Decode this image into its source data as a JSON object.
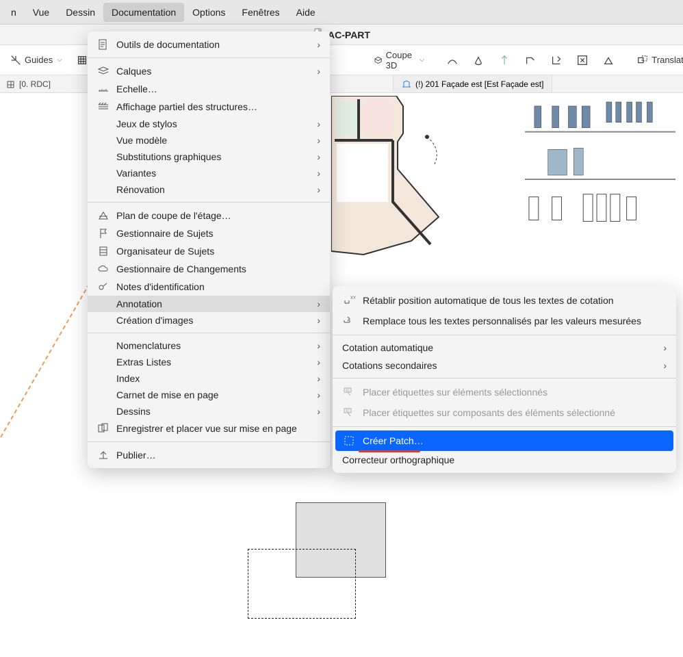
{
  "menubar": {
    "items": [
      "n",
      "Vue",
      "Dessin",
      "Documentation",
      "Options",
      "Fenêtres",
      "Aide"
    ],
    "active_index": 3
  },
  "window_title": "AC-PART",
  "toolbar": {
    "guides": "Guides",
    "coupe3d": "Coupe 3D",
    "translation": "Translation"
  },
  "tabs": {
    "left": "[0. RDC]",
    "right": "(!) 201 Façade est [Est Façade est]"
  },
  "dropdown": {
    "items": [
      {
        "label": "Outils de documentation",
        "arrow": true,
        "icon": "doc-tools"
      },
      {
        "sep": true
      },
      {
        "label": "Calques",
        "arrow": true,
        "icon": "layers"
      },
      {
        "label": "Echelle…",
        "icon": "scale"
      },
      {
        "label": "Affichage partiel des structures…",
        "icon": "partial"
      },
      {
        "label": "Jeux de stylos",
        "arrow": true,
        "noic": true
      },
      {
        "label": "Vue modèle",
        "arrow": true,
        "noic": true
      },
      {
        "label": "Substitutions graphiques",
        "arrow": true,
        "noic": true
      },
      {
        "label": "Variantes",
        "arrow": true,
        "noic": true
      },
      {
        "label": "Rénovation",
        "arrow": true,
        "noic": true
      },
      {
        "sep": true
      },
      {
        "label": "Plan de coupe de l'étage…",
        "icon": "cutplane"
      },
      {
        "label": "Gestionnaire de Sujets",
        "icon": "flag"
      },
      {
        "label": "Organisateur de Sujets",
        "icon": "org"
      },
      {
        "label": "Gestionnaire de Changements",
        "icon": "cloud"
      },
      {
        "label": "Notes d'identification",
        "icon": "note"
      },
      {
        "label": "Annotation",
        "arrow": true,
        "noic": true,
        "hovered": true
      },
      {
        "label": "Création d'images",
        "arrow": true,
        "noic": true
      },
      {
        "sep": true
      },
      {
        "label": "Nomenclatures",
        "arrow": true,
        "noic": true
      },
      {
        "label": "Extras Listes",
        "arrow": true,
        "noic": true
      },
      {
        "label": "Index",
        "arrow": true,
        "noic": true
      },
      {
        "label": "Carnet de mise en page",
        "arrow": true,
        "noic": true
      },
      {
        "label": "Dessins",
        "arrow": true,
        "noic": true
      },
      {
        "label": "Enregistrer et placer vue sur mise en page",
        "icon": "save"
      },
      {
        "sep": true
      },
      {
        "label": "Publier…",
        "icon": "publish"
      }
    ]
  },
  "submenu": {
    "items": [
      {
        "label": "Rétablir position automatique de tous les textes de cotation",
        "icon": "restore"
      },
      {
        "label": "Remplace tous les textes personnalisés par les valeurs mesurées",
        "icon": "replace"
      },
      {
        "sep": true
      },
      {
        "label": "Cotation automatique",
        "arrow": true,
        "noic": true
      },
      {
        "label": "Cotations secondaires",
        "arrow": true,
        "noic": true
      },
      {
        "sep": true
      },
      {
        "label": "Placer étiquettes sur éléments sélectionnés",
        "icon": "label",
        "disabled": true
      },
      {
        "label": "Placer étiquettes sur composants des éléments sélectionné",
        "icon": "label",
        "disabled": true
      },
      {
        "sep": true
      },
      {
        "label": "Créer Patch…",
        "icon": "patch",
        "selected": true,
        "underline": true
      },
      {
        "label": "Correcteur orthographique",
        "noic": true
      }
    ]
  }
}
